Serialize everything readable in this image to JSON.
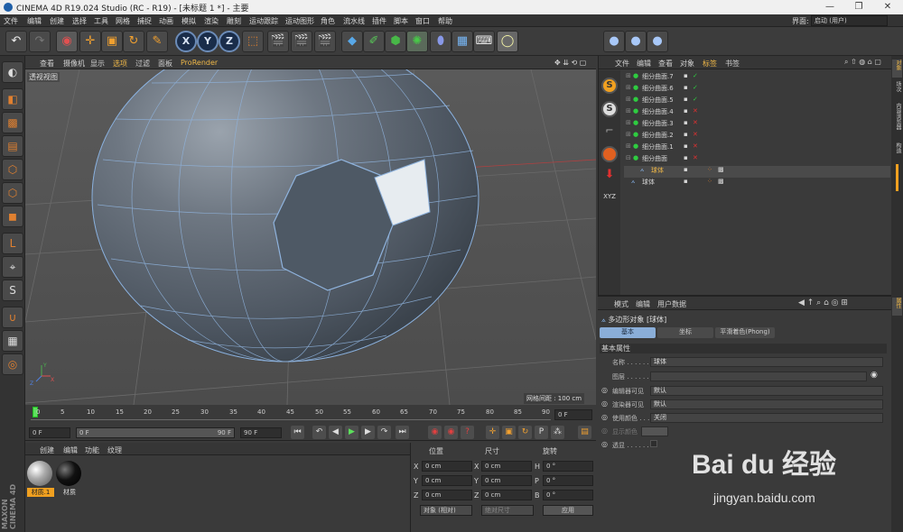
{
  "window": {
    "title": "CINEMA 4D R19.024 Studio (RC - R19) - [未标题 1 *] - 主要",
    "minimize": "—",
    "maximize": "❐",
    "close": "✕"
  },
  "menubar": {
    "items": [
      "文件",
      "编辑",
      "创建",
      "选择",
      "工具",
      "网格",
      "捕捉",
      "动画",
      "模拟",
      "渲染",
      "雕刻",
      "运动跟踪",
      "运动图形",
      "角色",
      "流水线",
      "插件",
      "脚本",
      "窗口",
      "帮助"
    ],
    "layout_label": "界面:",
    "layout_value": "启动 (用户)"
  },
  "viewport": {
    "menu": [
      "查看",
      "摄像机",
      "显示",
      "选项",
      "过滤",
      "面板",
      "ProRender"
    ],
    "label": "透视视图",
    "grid_spacing": "网格间距 : 100 cm"
  },
  "timeline": {
    "ticks": [
      "0",
      "5",
      "10",
      "15",
      "20",
      "25",
      "30",
      "35",
      "40",
      "45",
      "50",
      "55",
      "60",
      "65",
      "70",
      "75",
      "80",
      "85",
      "90"
    ],
    "current": "0 F"
  },
  "playbar": {
    "start": "0 F",
    "current": "0 F",
    "end_inner": "90 F",
    "end": "90 F"
  },
  "materials": {
    "menu": [
      "创建",
      "编辑",
      "功能",
      "纹理"
    ],
    "items": [
      {
        "name": "材质.1",
        "selected": true
      },
      {
        "name": "材质",
        "selected": false
      }
    ]
  },
  "coords": {
    "headers": [
      "位置",
      "尺寸",
      "旋转"
    ],
    "rows": [
      {
        "axis": "X",
        "pos": "0 cm",
        "size": "0 cm",
        "rot_axis": "H",
        "rot": "0 °"
      },
      {
        "axis": "Y",
        "pos": "0 cm",
        "size": "0 cm",
        "rot_axis": "P",
        "rot": "0 °"
      },
      {
        "axis": "Z",
        "pos": "0 cm",
        "size": "0 cm",
        "rot_axis": "B",
        "rot": "0 °"
      }
    ],
    "mode": "对象 (相对)",
    "size_mode": "绝对尺寸",
    "apply": "应用"
  },
  "objects": {
    "menu": [
      "文件",
      "编辑",
      "查看",
      "对象",
      "标签",
      "书签"
    ],
    "items": [
      {
        "name": "细分曲面.7",
        "green": true
      },
      {
        "name": "细分曲面.6",
        "green": true
      },
      {
        "name": "细分曲面.5",
        "green": true
      },
      {
        "name": "细分曲面.4",
        "green": false
      },
      {
        "name": "细分曲面.3",
        "green": false
      },
      {
        "name": "细分曲面.2",
        "green": false
      },
      {
        "name": "细分曲面.1",
        "green": false
      },
      {
        "name": "细分曲面",
        "green": false
      },
      {
        "name": "球体",
        "green": false
      },
      {
        "name": "球体",
        "green": false
      }
    ]
  },
  "attributes": {
    "menu": [
      "模式",
      "编辑",
      "用户数据"
    ],
    "object_title": "多边形对象 [球体]",
    "tabs": [
      "基本",
      "坐标",
      "平滑着色(Phong)"
    ],
    "section": "基本属性",
    "fields": [
      {
        "label": "名称 . . . . . . .",
        "value": "球体"
      },
      {
        "label": "图层 . . . . . . .",
        "value": ""
      },
      {
        "label": "编辑器可见",
        "value": "默认"
      },
      {
        "label": "渲染器可见",
        "value": "默认"
      },
      {
        "label": "使用颜色 . . .",
        "value": "关闭"
      },
      {
        "label": "显示颜色",
        "value": ""
      },
      {
        "label": "透显 . . . . . . .",
        "value": ""
      }
    ]
  },
  "rightstrip": {
    "tabs": [
      "对象",
      "场次",
      "内容浏览器",
      "构造"
    ],
    "attr_tab": "属性"
  },
  "watermark": {
    "brand": "Bai du 经验",
    "url": "jingyan.baidu.com"
  },
  "maxon": "MAXON CINEMA 4D"
}
